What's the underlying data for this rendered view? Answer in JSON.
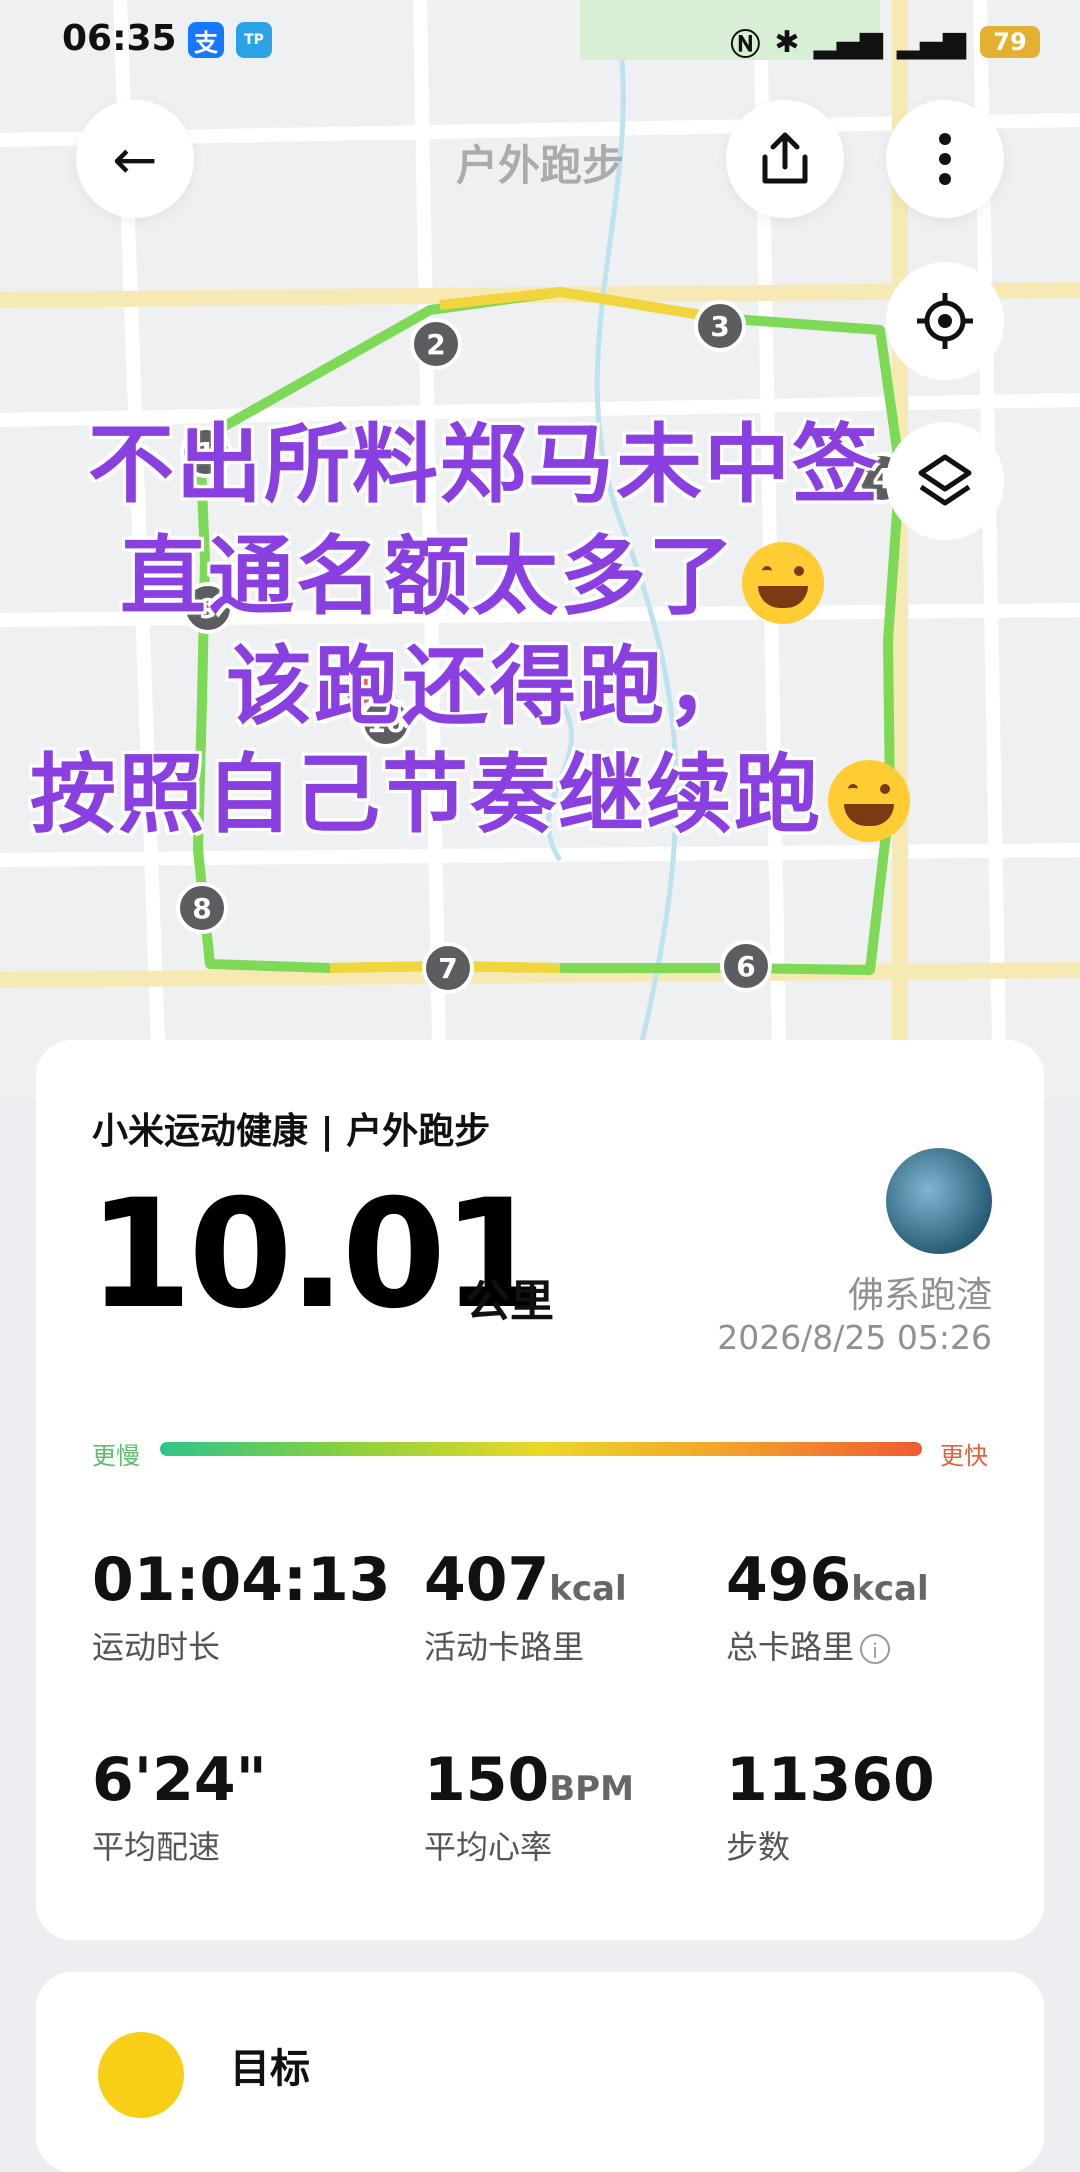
{
  "status_bar": {
    "time": "06:35",
    "battery": "79",
    "app_icons": [
      "alipay-icon",
      "tplink-icon"
    ],
    "indicators": [
      "nfc-icon",
      "bluetooth-icon",
      "signal-5g-icon",
      "signal-5g-icon"
    ]
  },
  "header": {
    "title": "户外跑步",
    "back_icon": "back-arrow-icon",
    "share_icon": "share-icon",
    "more_icon": "more-vertical-icon"
  },
  "map": {
    "locate_icon": "locate-icon",
    "layers_icon": "layers-icon",
    "km_markers": [
      "1",
      "2",
      "3",
      "4",
      "6",
      "7",
      "8",
      "9",
      "10"
    ]
  },
  "overlay": {
    "line1": "不出所料郑马未中签",
    "line2": "直通名额太多了",
    "line3": "该跑还得跑，",
    "line4": "按照自己节奏继续跑"
  },
  "summary": {
    "brand": "小米运动健康 | 户外跑步",
    "distance": "10.01",
    "distance_unit": "公里",
    "username": "佛系跑渣",
    "datetime": "2026/8/25 05:26",
    "slower_label": "更慢",
    "faster_label": "更快"
  },
  "stats": [
    {
      "value": "01:04:13",
      "unit": "",
      "label": "运动时长"
    },
    {
      "value": "407",
      "unit": "kcal",
      "label": "活动卡路里"
    },
    {
      "value": "496",
      "unit": "kcal",
      "label": "总卡路里"
    },
    {
      "value": "6'24\"",
      "unit": "",
      "label": "平均配速"
    },
    {
      "value": "150",
      "unit": "BPM",
      "label": "平均心率"
    },
    {
      "value": "11360",
      "unit": "",
      "label": "步数"
    }
  ],
  "next_card": {
    "title": "目标"
  },
  "colors": {
    "accent": "#8a3fe0",
    "route_green": "#7ed957",
    "route_yellow": "#f2d53c",
    "badge_gray": "#5b5d60"
  }
}
